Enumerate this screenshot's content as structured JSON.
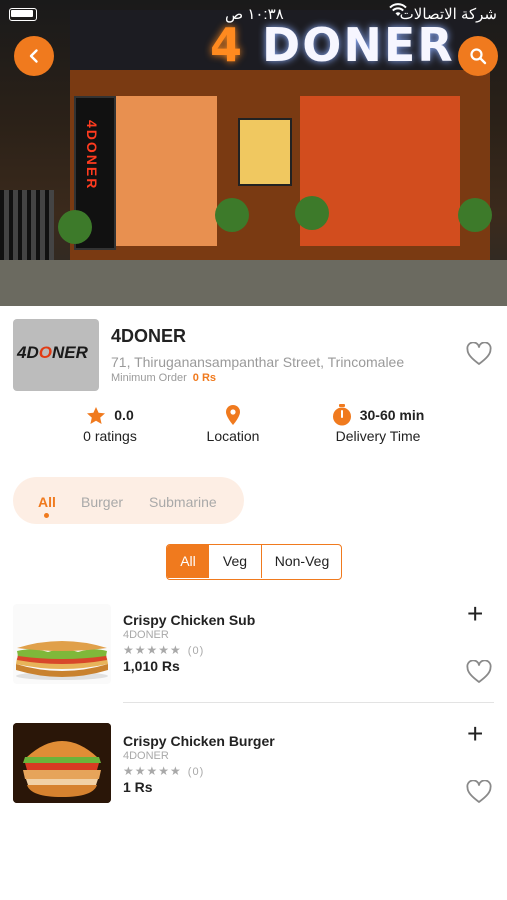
{
  "status_bar": {
    "carrier": "شركة الاتصالات",
    "time": "١٠:٣٨ ص"
  },
  "hero": {
    "sign_prefix": "4",
    "sign_text": "DONER",
    "pillar_text": "4DONER"
  },
  "restaurant": {
    "logo_text_a": "4D",
    "logo_text_o": "O",
    "logo_text_b": "NER",
    "name": "4DONER",
    "address": "71, Thiruganansampanthar Street, Trincomalee",
    "min_order_label": "Minimum Order",
    "min_order_value": "0 Rs"
  },
  "stats": {
    "rating_value": "0.0",
    "rating_label": "0 ratings",
    "location_label": "Location",
    "delivery_value": "30-60 min",
    "delivery_label": "Delivery Time"
  },
  "category_tabs": [
    "All",
    "Burger",
    "Submarine"
  ],
  "diet_filter": [
    "All",
    "Veg",
    "Non-Veg"
  ],
  "items": [
    {
      "name": "Crispy Chicken Sub",
      "shop": "4DONER",
      "stars": "★★★★★",
      "rating_count": "(0)",
      "price": "1,010 Rs"
    },
    {
      "name": "Crispy Chicken Burger",
      "shop": "4DONER",
      "stars": "★★★★★",
      "rating_count": "(0)",
      "price": "1 Rs"
    }
  ],
  "icons": {
    "add": "+",
    "accent": "#f07a1e"
  }
}
